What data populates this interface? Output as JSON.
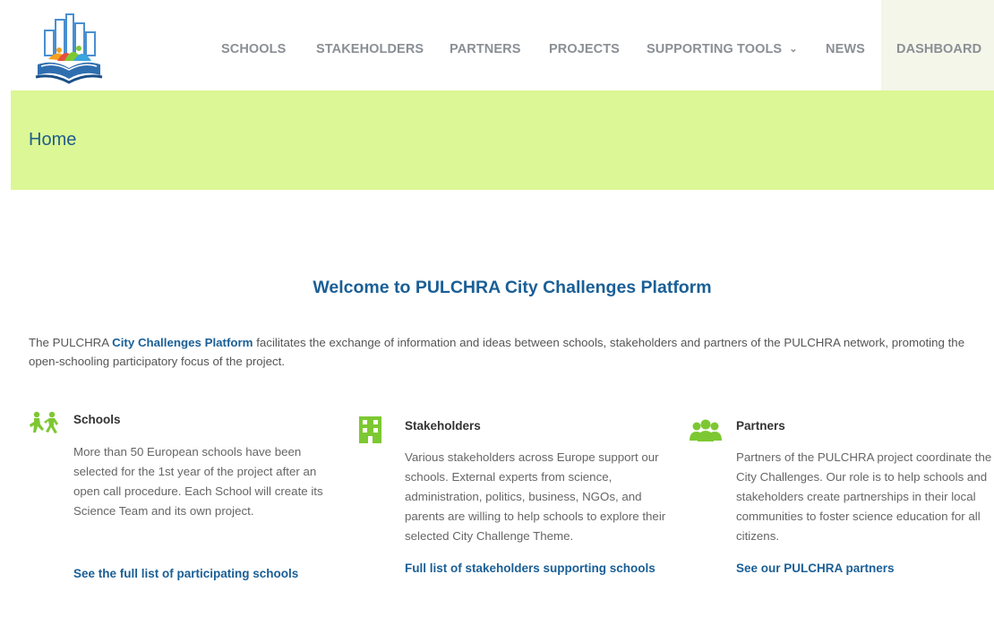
{
  "nav": {
    "items": [
      {
        "label": "SCHOOLS"
      },
      {
        "label": "STAKEHOLDERS"
      },
      {
        "label": "PARTNERS"
      },
      {
        "label": "PROJECTS"
      },
      {
        "label": "SUPPORTING TOOLS"
      },
      {
        "label": "NEWS"
      },
      {
        "label": "DASHBOARD"
      }
    ]
  },
  "banner": {
    "title": "Home"
  },
  "welcome": {
    "title": "Welcome to PULCHRA City Challenges Platform"
  },
  "intro": {
    "prefix": "The PULCHRA ",
    "link": "City Challenges Platform",
    "suffix": " facilitates the exchange of information and ideas between schools, stakeholders and partners of the PULCHRA network, promoting the open-schooling participatory focus of the project."
  },
  "columns": [
    {
      "title": "Schools",
      "body": "More than 50 European schools  have been selected for the 1st year of the project after an open call procedure. Each School will create its Science Team and its own project.",
      "link": "See the full list of participating schools"
    },
    {
      "title": "Stakeholders",
      "body": "Various stakeholders across Europe support our schools. External experts from science, administration, politics, business, NGOs, and parents are willing to help schools to explore their selected City Challenge Theme.",
      "link": "Full list of stakeholders supporting schools"
    },
    {
      "title": "Partners",
      "body": "Partners of the PULCHRA project coordinate the City Challenges. Our role is to help schools and stakeholders  create partnerships in their local communities to foster science education for all citizens.",
      "link": "See our PULCHRA partners"
    }
  ],
  "colors": {
    "accent": "#1a5f96",
    "banner": "#dcf795",
    "icon_green": "#7dc832"
  }
}
